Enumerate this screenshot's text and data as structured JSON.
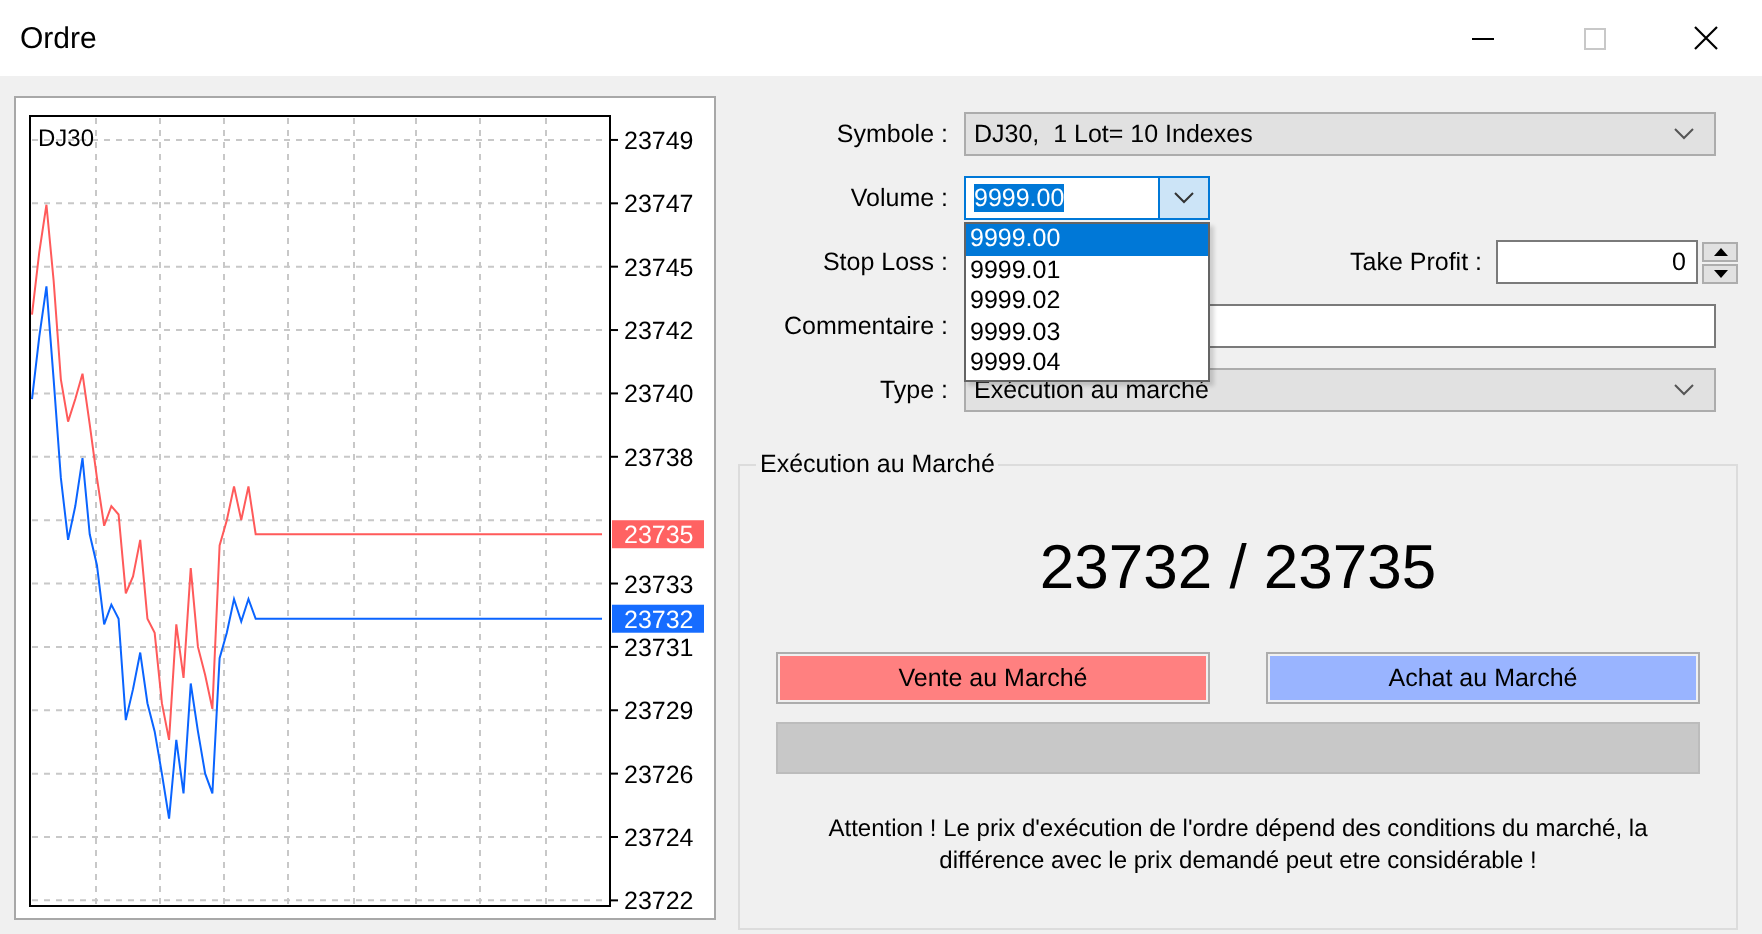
{
  "window": {
    "title": "Ordre",
    "maximize_disabled": true
  },
  "chart": {
    "symbol": "DJ30",
    "chart_data": {
      "type": "line",
      "grid": true,
      "categories": [
        null,
        null,
        null,
        null,
        null,
        null,
        null,
        null,
        null,
        null,
        null,
        null,
        null,
        null,
        null,
        null,
        null,
        null,
        null,
        null,
        null,
        null,
        null,
        null,
        null,
        null,
        null,
        null,
        null,
        null,
        null,
        null,
        null,
        null,
        null,
        null,
        null,
        null,
        null,
        null,
        null,
        null,
        null,
        null,
        null,
        null,
        null,
        null,
        null,
        null,
        null,
        null,
        null,
        null,
        null,
        null,
        null,
        null,
        null,
        null,
        null,
        null,
        null,
        null,
        null,
        null,
        null,
        null,
        null,
        null,
        null,
        null,
        null,
        null,
        null,
        null,
        null,
        null,
        null,
        null
      ],
      "ylim": [
        23721.8,
        23749.85
      ],
      "series": [
        {
          "color": "#ff5a5a",
          "values": [
            23742.8,
            23745,
            23746.7,
            23744,
            23740.5,
            23739,
            23739.8,
            23740.7,
            23738.9,
            23737,
            23735.3,
            23736,
            23735.7,
            23732.9,
            23733.5,
            23734.8,
            23732,
            23731.5,
            23729,
            23727.7,
            23731.8,
            23729.9,
            23733.8,
            23731,
            23730,
            23728.8,
            23734.6,
            23735.5,
            23736.7,
            23735.5,
            23736.7,
            23735,
            23735,
            23735,
            23735,
            23735,
            23735,
            23735,
            23735,
            23735,
            23735,
            23735,
            23735,
            23735,
            23735,
            23735,
            23735,
            23735,
            23735,
            23735,
            23735,
            23735,
            23735,
            23735,
            23735,
            23735,
            23735,
            23735,
            23735,
            23735,
            23735,
            23735,
            23735,
            23735,
            23735,
            23735,
            23735,
            23735,
            23735,
            23735,
            23735,
            23735,
            23735,
            23735,
            23735,
            23735,
            23735,
            23735,
            23735,
            23735
          ]
        },
        {
          "color": "#0a64ff",
          "values": [
            23739.8,
            23742,
            23743.8,
            23740.5,
            23737,
            23734.8,
            23736,
            23737.7,
            23735,
            23733.9,
            23731.8,
            23732.5,
            23732,
            23728.4,
            23729.5,
            23730.8,
            23729,
            23728,
            23726.5,
            23724.9,
            23727.7,
            23725.8,
            23729.7,
            23728,
            23726.5,
            23725.8,
            23730.6,
            23731.5,
            23732.7,
            23731.9,
            23732.7,
            23732,
            23732,
            23732,
            23732,
            23732,
            23732,
            23732,
            23732,
            23732,
            23732,
            23732,
            23732,
            23732,
            23732,
            23732,
            23732,
            23732,
            23732,
            23732,
            23732,
            23732,
            23732,
            23732,
            23732,
            23732,
            23732,
            23732,
            23732,
            23732,
            23732,
            23732,
            23732,
            23732,
            23732,
            23732,
            23732,
            23732,
            23732,
            23732,
            23732,
            23732,
            23732,
            23732,
            23732,
            23732,
            23732,
            23732,
            23732,
            23732
          ]
        }
      ],
      "yticks": [
        {
          "value": 23749,
          "label": "23749"
        },
        {
          "value": 23746.75,
          "label": "23747"
        },
        {
          "value": 23744.5,
          "label": "23745"
        },
        {
          "value": 23742.25,
          "label": "23742"
        },
        {
          "value": 23740,
          "label": "23740"
        },
        {
          "value": 23737.75,
          "label": "23738"
        },
        {
          "value": 23733.25,
          "label": "23733"
        },
        {
          "value": 23731,
          "label": "23731"
        },
        {
          "value": 23728.75,
          "label": "23729"
        },
        {
          "value": 23726.5,
          "label": "23726"
        },
        {
          "value": 23724.25,
          "label": "23724"
        },
        {
          "value": 23722,
          "label": "23722"
        }
      ]
    },
    "price_tags": [
      {
        "text": "23735"
      },
      {
        "text": "23732"
      }
    ]
  },
  "form": {
    "symbol": {
      "label": "Symbole :",
      "value": "DJ30,  1 Lot= 10 Indexes"
    },
    "volume": {
      "label": "Volume :",
      "value": "9999.00",
      "expanded": true,
      "options": [
        {
          "text": "9999.00",
          "selected": true
        },
        {
          "text": "9999.01",
          "selected": false
        },
        {
          "text": "9999.02",
          "selected": false
        },
        {
          "text": "9999.03",
          "selected": false
        },
        {
          "text": "9999.04",
          "selected": false
        }
      ]
    },
    "stop_loss": {
      "label": "Stop Loss :"
    },
    "take_profit": {
      "label": "Take Profit :",
      "value": "0"
    },
    "comment": {
      "label": "Commentaire :"
    },
    "type": {
      "label": "Type :",
      "value": "Exécution au marché"
    }
  },
  "execution": {
    "title": "Exécution au Marché",
    "prices": "23732 / 23735",
    "sell_button": "Vente au Marché",
    "buy_button": "Achat au Marché",
    "warning": "Attention ! Le prix d'exécution de l'ordre dépend des conditions du marché, la différence avec le prix demandé peut etre considérable !"
  }
}
